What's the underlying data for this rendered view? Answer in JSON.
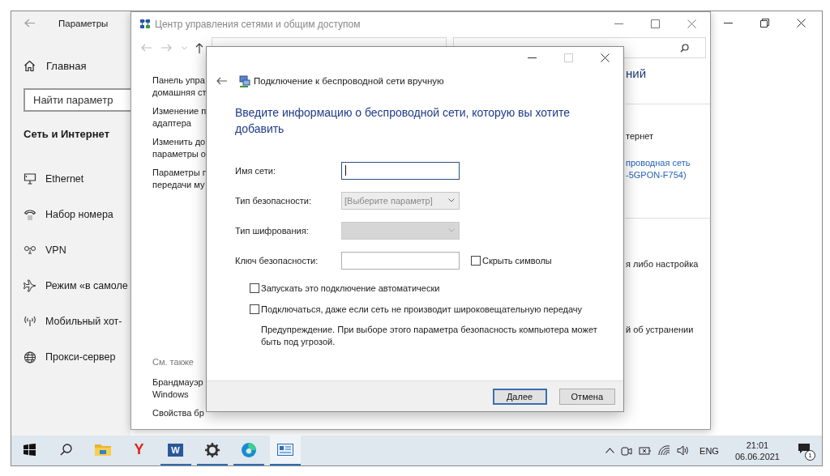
{
  "settings_window": {
    "title": "Параметры",
    "home": "Главная",
    "search": {
      "placeholder": "Найти параметр"
    },
    "section": "Сеть и Интернет",
    "nav_items": [
      {
        "kind": "ethernet",
        "label": "Ethernet"
      },
      {
        "kind": "dialup",
        "label": "Набор номера"
      },
      {
        "kind": "vpn",
        "label": "VPN"
      },
      {
        "kind": "airplane",
        "label": "Режим «в самоле"
      },
      {
        "kind": "hotspot",
        "label": "Мобильный хот-"
      },
      {
        "kind": "proxy",
        "label": "Прокси-сервер"
      }
    ]
  },
  "control_panel": {
    "title": "Центр управления сетями и общим доступом",
    "left_links": [
      "Панель упра\nдомашняя ст",
      "Изменение п\nадаптера",
      "Изменить до\nпараметры о",
      "Параметры п\nпередачи му"
    ],
    "see_also": "См. также",
    "see_also_links": [
      "Брандмауэр\nWindows",
      "Свойства бр"
    ],
    "right": {
      "heading": "ний",
      "connection_label": "тернет",
      "connection_link": "проводная сеть\n-5GPON-F754)",
      "texts": [
        "я либо настройка",
        "й об устранении"
      ]
    }
  },
  "dialog": {
    "title": "Подключение к беспроводной сети вручную",
    "heading": "Введите информацию о беспроводной сети, которую вы хотите добавить",
    "fields": [
      {
        "kind": "text",
        "label": "Имя сети:",
        "focused": true
      },
      {
        "kind": "select",
        "label": "Тип безопасности:",
        "value": "[Выберите параметр]",
        "disabled": false
      },
      {
        "kind": "select",
        "label": "Тип шифрования:",
        "disabled": true
      },
      {
        "kind": "password",
        "label": "Ключ безопасности:",
        "checkbox": {
          "label": "Скрыть символы",
          "checked": false
        }
      }
    ],
    "options": [
      {
        "label": "Запускать это подключение автоматически",
        "checked": false
      },
      {
        "label": "Подключаться, даже если сеть не производит широковещательную передачу",
        "checked": false
      }
    ],
    "warning": "Предупреждение. При выборе этого параметра безопасность компьютера может быть под угрозой.",
    "buttons": [
      {
        "label": "Далее",
        "default": true
      },
      {
        "label": "Отмена",
        "default": false
      }
    ]
  },
  "taskbar": {
    "apps": [
      {
        "kind": "start",
        "running": false,
        "active": false
      },
      {
        "kind": "search",
        "running": false,
        "active": false
      },
      {
        "kind": "explorer",
        "running": false,
        "active": false
      },
      {
        "kind": "yandex",
        "glyph": "Y",
        "running": false,
        "active": false
      },
      {
        "kind": "word",
        "glyph": "W",
        "running": true,
        "active": false
      },
      {
        "kind": "settings",
        "running": true,
        "active": false
      },
      {
        "kind": "edge",
        "running": true,
        "active": false
      },
      {
        "kind": "control-panel",
        "running": true,
        "active": true
      }
    ],
    "language": "ENG",
    "time": "21:01",
    "date": "06.06.2021",
    "notifications": "1"
  }
}
